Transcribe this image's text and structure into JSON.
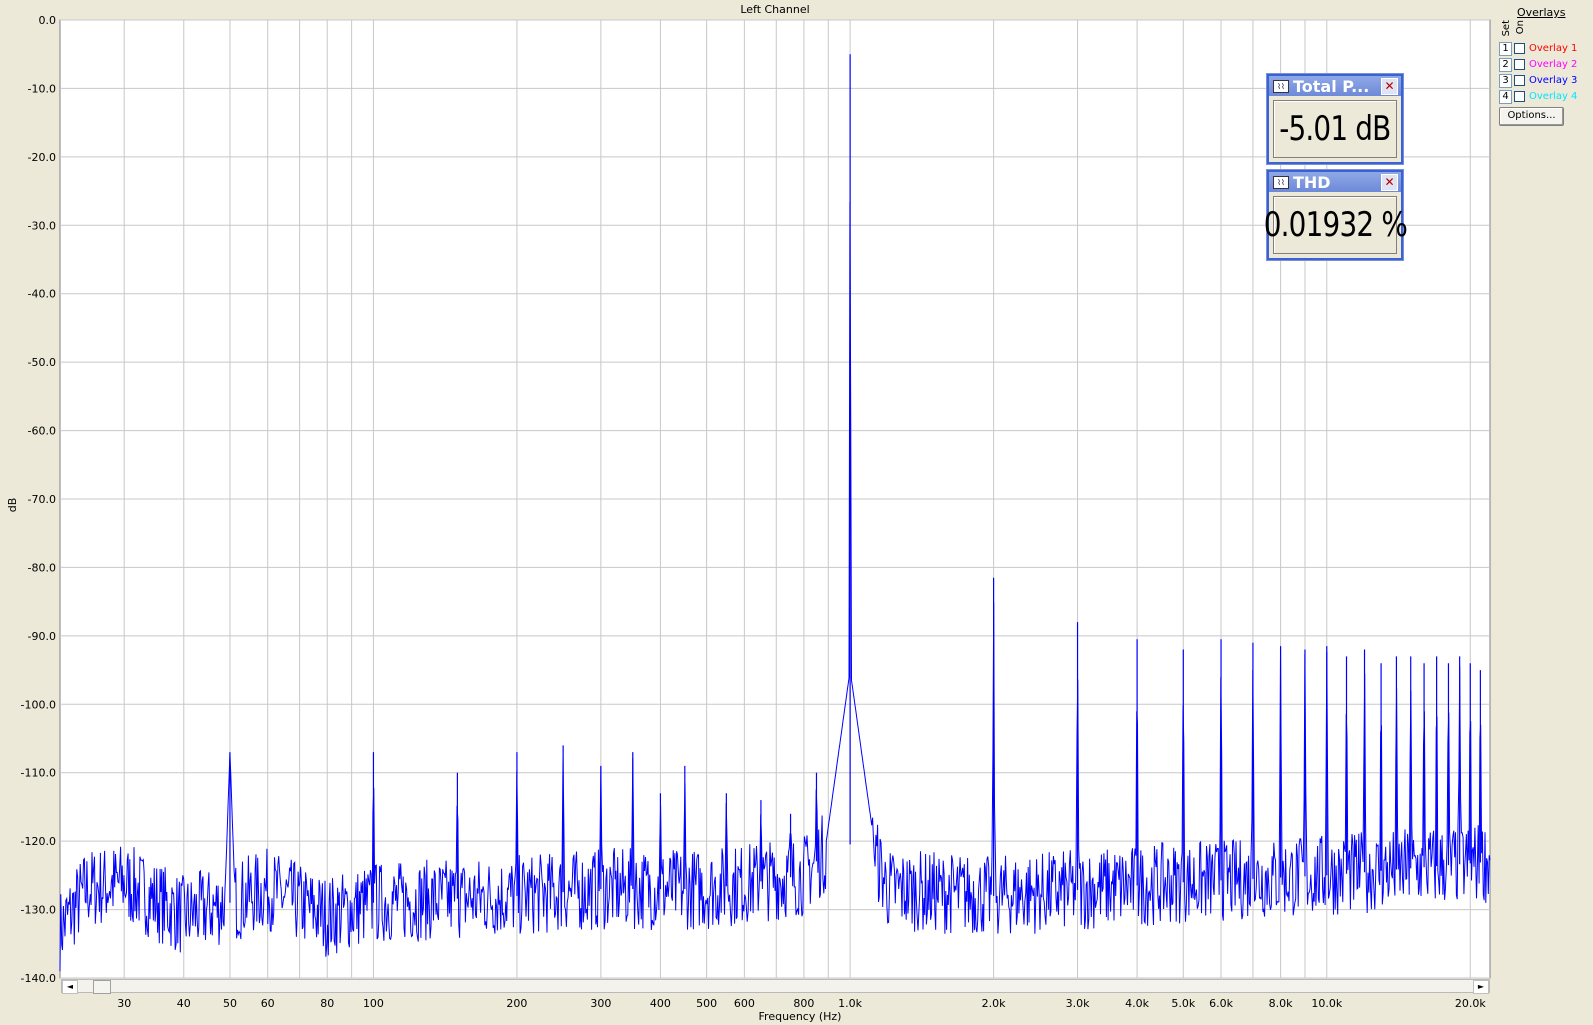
{
  "chart_data": {
    "type": "line",
    "title": "Left Channel",
    "xlabel": "Frequency (Hz)",
    "ylabel": "dB",
    "xscale": "log",
    "xlim": [
      22,
      22000
    ],
    "ylim": [
      -140,
      0
    ],
    "grid": true,
    "line_color": "#0000FF",
    "y_ticks": [
      0,
      -10,
      -20,
      -30,
      -40,
      -50,
      -60,
      -70,
      -80,
      -90,
      -100,
      -110,
      -120,
      -130,
      -140
    ],
    "y_tick_labels": [
      "0.0",
      "-10.0",
      "-20.0",
      "-30.0",
      "-40.0",
      "-50.0",
      "-60.0",
      "-70.0",
      "-80.0",
      "-90.0",
      "-100.0",
      "-110.0",
      "-120.0",
      "-130.0",
      "-140.0"
    ],
    "x_ticks": [
      30,
      40,
      50,
      60,
      80,
      100,
      200,
      300,
      400,
      500,
      600,
      800,
      1000,
      2000,
      3000,
      4000,
      5000,
      6000,
      8000,
      10000,
      20000
    ],
    "x_tick_labels": [
      "30",
      "40",
      "50",
      "60",
      "80",
      "100",
      "200",
      "300",
      "400",
      "500",
      "600",
      "800",
      "1.0k",
      "2.0k",
      "3.0k",
      "4.0k",
      "5.0k",
      "6.0k",
      "8.0k",
      "10.0k",
      "20.0k"
    ],
    "noise_floor": [
      [
        22,
        -133
      ],
      [
        25,
        -127
      ],
      [
        30,
        -126
      ],
      [
        40,
        -131
      ],
      [
        50,
        -129
      ],
      [
        60,
        -127
      ],
      [
        80,
        -131
      ],
      [
        100,
        -129
      ],
      [
        200,
        -128
      ],
      [
        300,
        -127
      ],
      [
        500,
        -127
      ],
      [
        800,
        -125
      ],
      [
        900,
        -121
      ],
      [
        1100,
        -120
      ],
      [
        1200,
        -127
      ],
      [
        2000,
        -128
      ],
      [
        5000,
        -126
      ],
      [
        10000,
        -125
      ],
      [
        22000,
        -123
      ]
    ],
    "peaks": [
      {
        "x": 50,
        "y": -107
      },
      {
        "x": 100,
        "y": -107
      },
      {
        "x": 150,
        "y": -110
      },
      {
        "x": 200,
        "y": -107
      },
      {
        "x": 250,
        "y": -106
      },
      {
        "x": 300,
        "y": -109
      },
      {
        "x": 350,
        "y": -107
      },
      {
        "x": 400,
        "y": -113
      },
      {
        "x": 450,
        "y": -109
      },
      {
        "x": 550,
        "y": -113
      },
      {
        "x": 650,
        "y": -114
      },
      {
        "x": 750,
        "y": -116
      },
      {
        "x": 850,
        "y": -110
      },
      {
        "x": 1000,
        "y": -5
      },
      {
        "x": 2000,
        "y": -81.5
      },
      {
        "x": 3000,
        "y": -88
      },
      {
        "x": 4000,
        "y": -90.5
      },
      {
        "x": 5000,
        "y": -92
      },
      {
        "x": 6000,
        "y": -90.5
      },
      {
        "x": 7000,
        "y": -91
      },
      {
        "x": 8000,
        "y": -91.5
      },
      {
        "x": 9000,
        "y": -92
      },
      {
        "x": 10000,
        "y": -91.5
      },
      {
        "x": 11000,
        "y": -93
      },
      {
        "x": 12000,
        "y": -92
      },
      {
        "x": 13000,
        "y": -94
      },
      {
        "x": 14000,
        "y": -93
      },
      {
        "x": 15000,
        "y": -93
      },
      {
        "x": 16000,
        "y": -94
      },
      {
        "x": 17000,
        "y": -93
      },
      {
        "x": 18000,
        "y": -94
      },
      {
        "x": 19000,
        "y": -93
      },
      {
        "x": 20000,
        "y": -94
      },
      {
        "x": 21000,
        "y": -95
      }
    ]
  },
  "overlays": {
    "title": "Overlays",
    "col_set": "Set",
    "col_on": "On",
    "items": [
      {
        "set": "1",
        "label": "Overlay 1",
        "color": "#FF0000"
      },
      {
        "set": "2",
        "label": "Overlay 2",
        "color": "#FF00FF"
      },
      {
        "set": "3",
        "label": "Overlay 3",
        "color": "#0000FF"
      },
      {
        "set": "4",
        "label": "Overlay 4",
        "color": "#00E5FF"
      }
    ],
    "options_label": "Options..."
  },
  "meters": {
    "total_power": {
      "title": "Total P...",
      "value": "-5.01 dB",
      "icon": "waveform-icon"
    },
    "thd": {
      "title": "THD",
      "value": "0.01932 %",
      "icon": "waveform-icon"
    }
  },
  "scrollbar": {
    "left_arrow": "◄",
    "right_arrow": "►"
  }
}
